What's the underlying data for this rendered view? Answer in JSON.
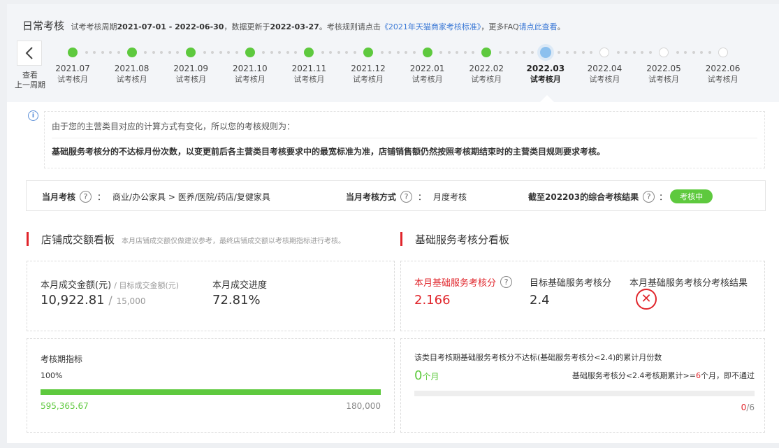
{
  "header": {
    "title": "日常考核",
    "period_prefix": "试考考核周期",
    "period": "2021-07-01 - 2022-06-30",
    "update_prefix": "，数据更新于",
    "update_date": "2022-03-27",
    "rule_prefix": "。考核规则请点击",
    "rule_link": "《2021年天猫商家考核标准》",
    "faq_prefix": "，更多FAQ",
    "faq_link": "请点此查看",
    "faq_suffix": "。"
  },
  "back": {
    "icon": "chevron-left-icon",
    "label_line1": "查看",
    "label_line2": "上一周期"
  },
  "timeline": [
    {
      "month": "2021.07",
      "status": "试考核月",
      "state": "done"
    },
    {
      "month": "2021.08",
      "status": "试考核月",
      "state": "done"
    },
    {
      "month": "2021.09",
      "status": "试考核月",
      "state": "done"
    },
    {
      "month": "2021.10",
      "status": "试考核月",
      "state": "done"
    },
    {
      "month": "2021.11",
      "status": "试考核月",
      "state": "done"
    },
    {
      "month": "2021.12",
      "status": "试考核月",
      "state": "done"
    },
    {
      "month": "2022.01",
      "status": "试考核月",
      "state": "done"
    },
    {
      "month": "2022.02",
      "status": "试考核月",
      "state": "done"
    },
    {
      "month": "2022.03",
      "status": "试考核月",
      "state": "current"
    },
    {
      "month": "2022.04",
      "status": "试考核月",
      "state": "todo"
    },
    {
      "month": "2022.05",
      "status": "试考核月",
      "state": "todo"
    },
    {
      "month": "2022.06",
      "status": "试考核月",
      "state": "todo"
    }
  ],
  "notice": {
    "icon": "info-icon",
    "line1": "由于您的主营类目对应的计算方式有变化，所以您的考核规则为：",
    "line2": "基础服务考核分的不达标月份次数，以变更前后各主营类目考核要求中的最宽标准为准，店铺销售额仍然按照考核期结束时的主营类目规则要求考核。"
  },
  "summary": {
    "month_assess_label": "当月考核",
    "category": "商业/办公家具 > 医养/医院/药店/复健家具",
    "method_label": "当月考核方式",
    "method": "月度考核",
    "result_label": "截至202203的综合考核结果",
    "result_badge": "考核中",
    "colon": "："
  },
  "sales": {
    "title": "店铺成交额看板",
    "hint": "本月店铺成交额仅做建议参考，最终店铺成交额以考核期指标进行考核。",
    "amount_label": "本月成交金额(元)",
    "target_label": "/ 目标成交金额(元)",
    "amount": "10,922.81",
    "target": "15,000",
    "progress_label": "本月成交进度",
    "progress": "72.81%",
    "period_label": "考核期指标",
    "period_percent": "100%",
    "period_fraction": 1.0,
    "period_value": "595,365.67",
    "period_target": "180,000"
  },
  "service": {
    "title": "基础服务考核分看板",
    "score_label": "本月基础服务考核分",
    "score": "2.166",
    "target_label": "目标基础服务考核分",
    "target": "2.4",
    "result_label": "本月基础服务考核分考核结果",
    "result_icon": "fail-x-icon",
    "count_title": "该类目考核期基础服务考核分不达标(基础服务考核分<2.4)的累计月份数",
    "count_value": "0",
    "count_unit": "个月",
    "rule_prefix": "基础服务考核分<2.4考核期累计>=",
    "rule_num": "6",
    "rule_suffix": "个月，即不通过",
    "count_fraction": 0,
    "ratio_num": "0",
    "ratio_den": "/6"
  },
  "colors": {
    "green": "#5ec93e",
    "red": "#e0252b",
    "blue": "#3d7ad6"
  }
}
